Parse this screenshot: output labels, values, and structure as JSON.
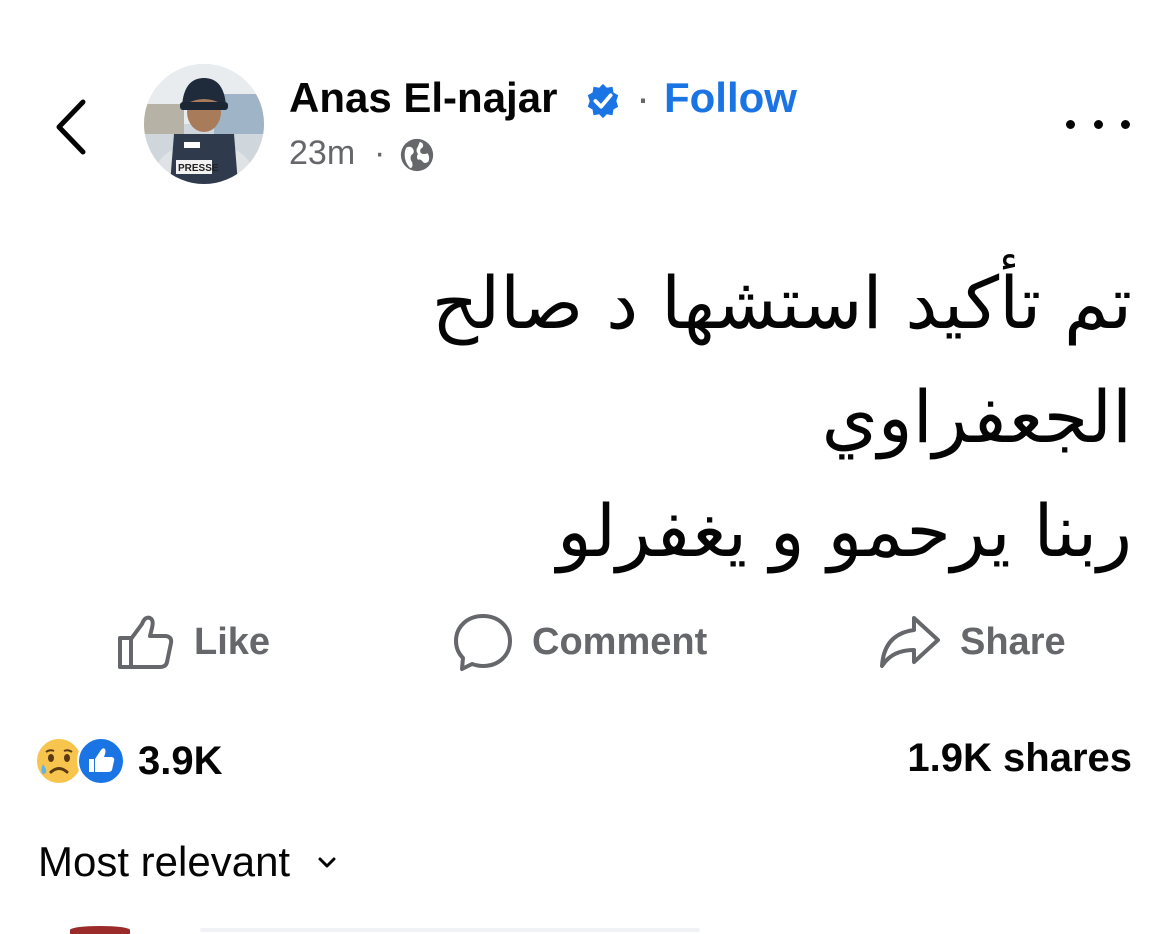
{
  "header": {
    "author_name": "Anas El-najar",
    "follow_label": "Follow",
    "separator": "·",
    "timestamp": "23m",
    "audience_icon": "globe-icon",
    "verified_icon": "verified-badge-icon",
    "back_icon": "chevron-left-icon",
    "more_icon": "more-horizontal-icon"
  },
  "post": {
    "text": "تم تأكيد استشها د صالح\nالجعفراوي\nربنا يرحمو و يغفرلو"
  },
  "actions": {
    "like_label": "Like",
    "comment_label": "Comment",
    "share_label": "Share"
  },
  "stats": {
    "reaction_count": "3.9K",
    "reaction_icons": [
      "sad-reaction-icon",
      "like-reaction-icon"
    ],
    "shares": "1.9K shares"
  },
  "comments": {
    "sort_label": "Most relevant"
  },
  "colors": {
    "accent": "#1b74e4",
    "secondary_text": "#65676b",
    "primary_text": "#050505"
  }
}
